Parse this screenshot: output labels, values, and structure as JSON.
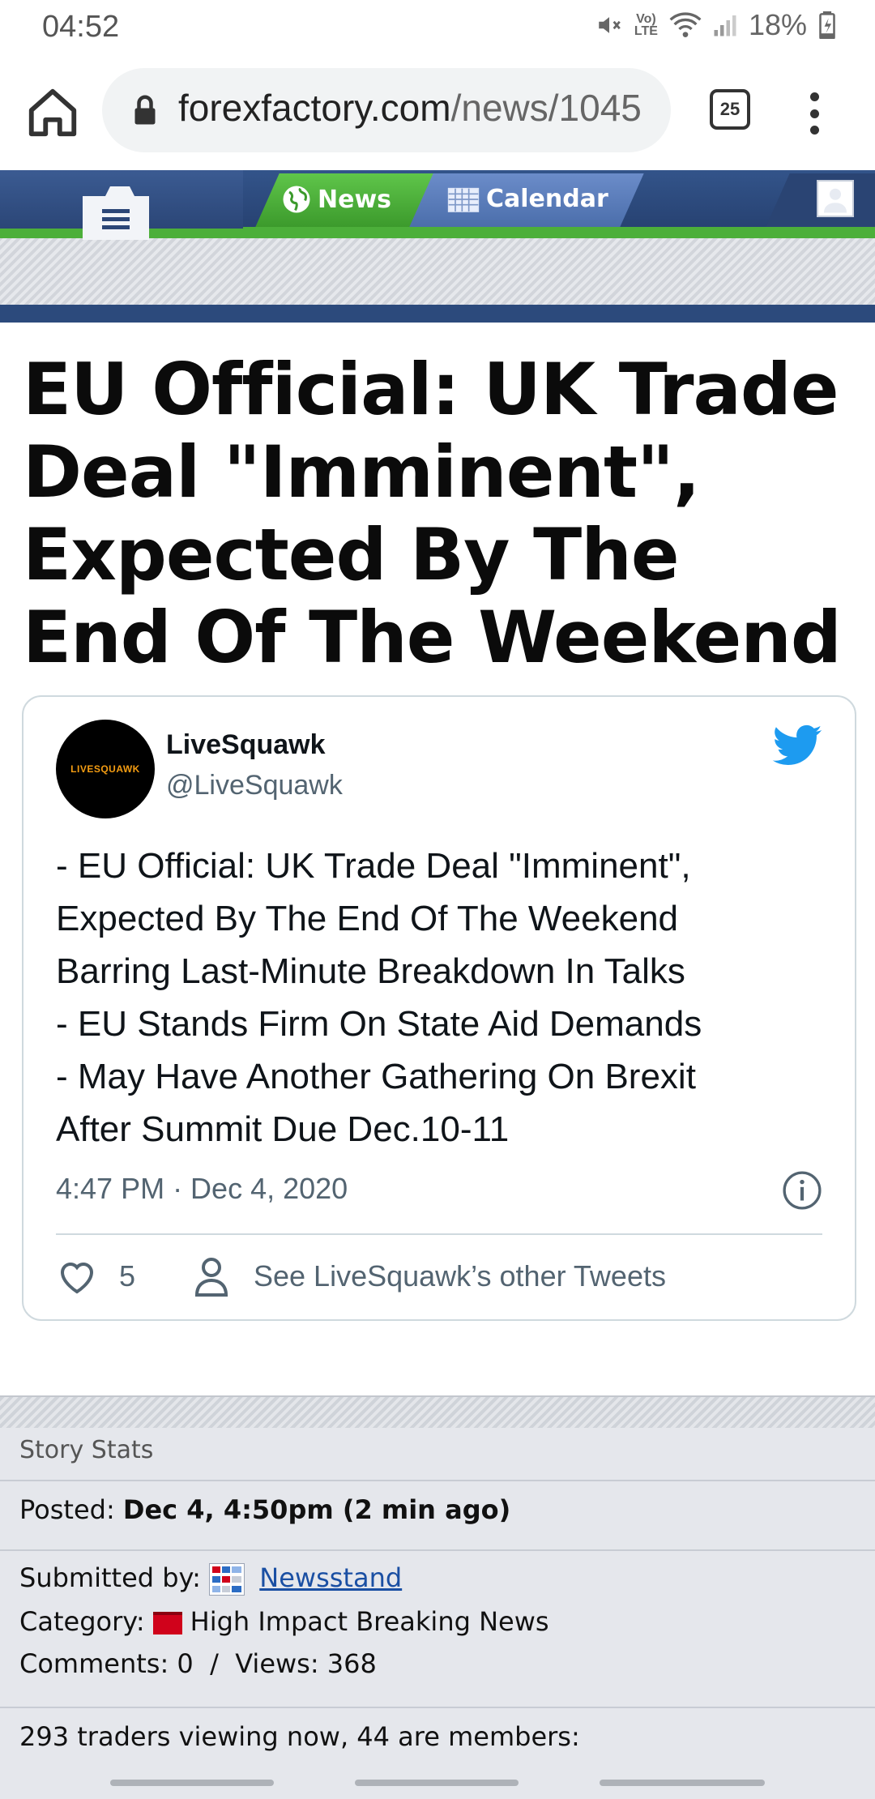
{
  "status_bar": {
    "time": "04:52",
    "volte_top": "Vo)",
    "volte_bottom": "LTE",
    "battery": "18%"
  },
  "browser": {
    "url_host": "forexfactory.com",
    "url_path": "/news/1045",
    "tab_count": "25"
  },
  "site_nav": {
    "news_label": "News",
    "calendar_label": "Calendar"
  },
  "article": {
    "title": "EU Official: UK Trade Deal \"Imminent\", Expected By The End Of The Weekend"
  },
  "tweet": {
    "avatar_text": "LIVESQUAWK",
    "author_name": "LiveSquawk",
    "author_handle": "@LiveSquawk",
    "lines": [
      "- EU Official: UK Trade Deal \"Imminent\",",
      "Expected By The End Of The Weekend",
      "Barring Last-Minute Breakdown In Talks",
      "- EU Stands Firm On State Aid Demands",
      "- May Have Another Gathering On Brexit",
      "After Summit Due Dec.10-11"
    ],
    "timestamp": "4:47 PM · Dec 4, 2020",
    "likes": "5",
    "other_tweets_label": "See LiveSquawk’s other Tweets"
  },
  "story_stats": {
    "header": "Story Stats",
    "posted_label": "Posted:",
    "posted_value": "Dec 4, 4:50pm (2 min ago)",
    "submitted_label": "Submitted by:",
    "submitted_value": "Newsstand",
    "category_label": "Category:",
    "category_value": "High Impact Breaking News",
    "comments_label": "Comments:",
    "comments_value": "0",
    "views_label": "Views:",
    "views_value": "368",
    "viewers_text": "293 traders viewing now, 44 are members:"
  },
  "colors": {
    "header_blue": "#2c4a7c",
    "news_green": "#4caf3a",
    "twitter_blue": "#1d9bf0",
    "link_blue": "#1a4fa3",
    "category_red": "#d0021b"
  }
}
